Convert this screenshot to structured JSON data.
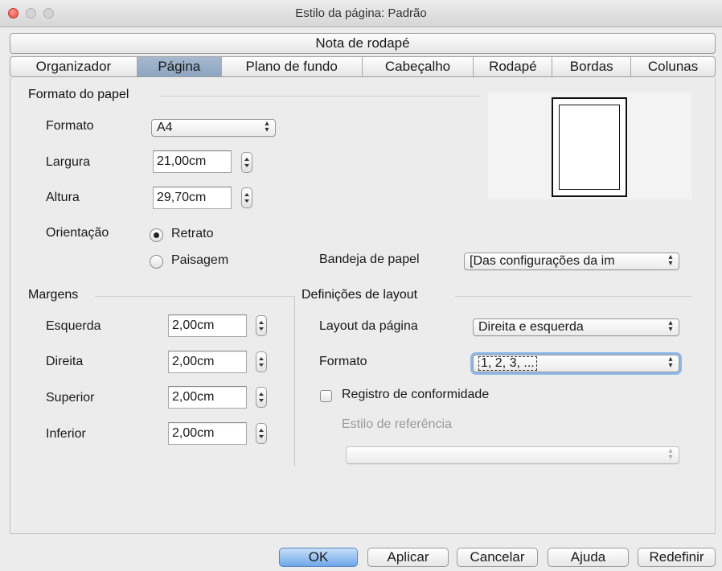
{
  "window": {
    "title": "Estilo da página: Padrão"
  },
  "tabs_top": [
    {
      "label": "Nota de rodapé"
    }
  ],
  "tabs": [
    {
      "label": "Organizador"
    },
    {
      "label": "Página"
    },
    {
      "label": "Plano de fundo"
    },
    {
      "label": "Cabeçalho"
    },
    {
      "label": "Rodapé"
    },
    {
      "label": "Bordas"
    },
    {
      "label": "Colunas"
    }
  ],
  "active_tab": "Página",
  "paper_format": {
    "heading": "Formato do papel",
    "format_label": "Formato",
    "format_value": "A4",
    "width_label": "Largura",
    "width_value": "21,00cm",
    "height_label": "Altura",
    "height_value": "29,70cm",
    "orientation_label": "Orientação",
    "portrait_label": "Retrato",
    "landscape_label": "Paisagem",
    "orientation_selected": "Retrato",
    "tray_label": "Bandeja de papel",
    "tray_value": "[Das configurações da im"
  },
  "margins": {
    "heading": "Margens",
    "left_label": "Esquerda",
    "left_value": "2,00cm",
    "right_label": "Direita",
    "right_value": "2,00cm",
    "top_label": "Superior",
    "top_value": "2,00cm",
    "bottom_label": "Inferior",
    "bottom_value": "2,00cm"
  },
  "layout": {
    "heading": "Definições de layout",
    "page_layout_label": "Layout da página",
    "page_layout_value": "Direita e esquerda",
    "format_label": "Formato",
    "format_value": "1, 2, 3, ...",
    "register_label": "Registro de conformidade",
    "register_checked": false,
    "ref_style_label": "Estilo de referência",
    "ref_style_value": ""
  },
  "buttons": {
    "ok": "OK",
    "apply": "Aplicar",
    "cancel": "Cancelar",
    "help": "Ajuda",
    "reset": "Redefinir"
  },
  "colors": {
    "active_tab": "#8ea5c1",
    "primary_button": "#6fa6e8",
    "focus_ring": "#8fb6e8"
  }
}
